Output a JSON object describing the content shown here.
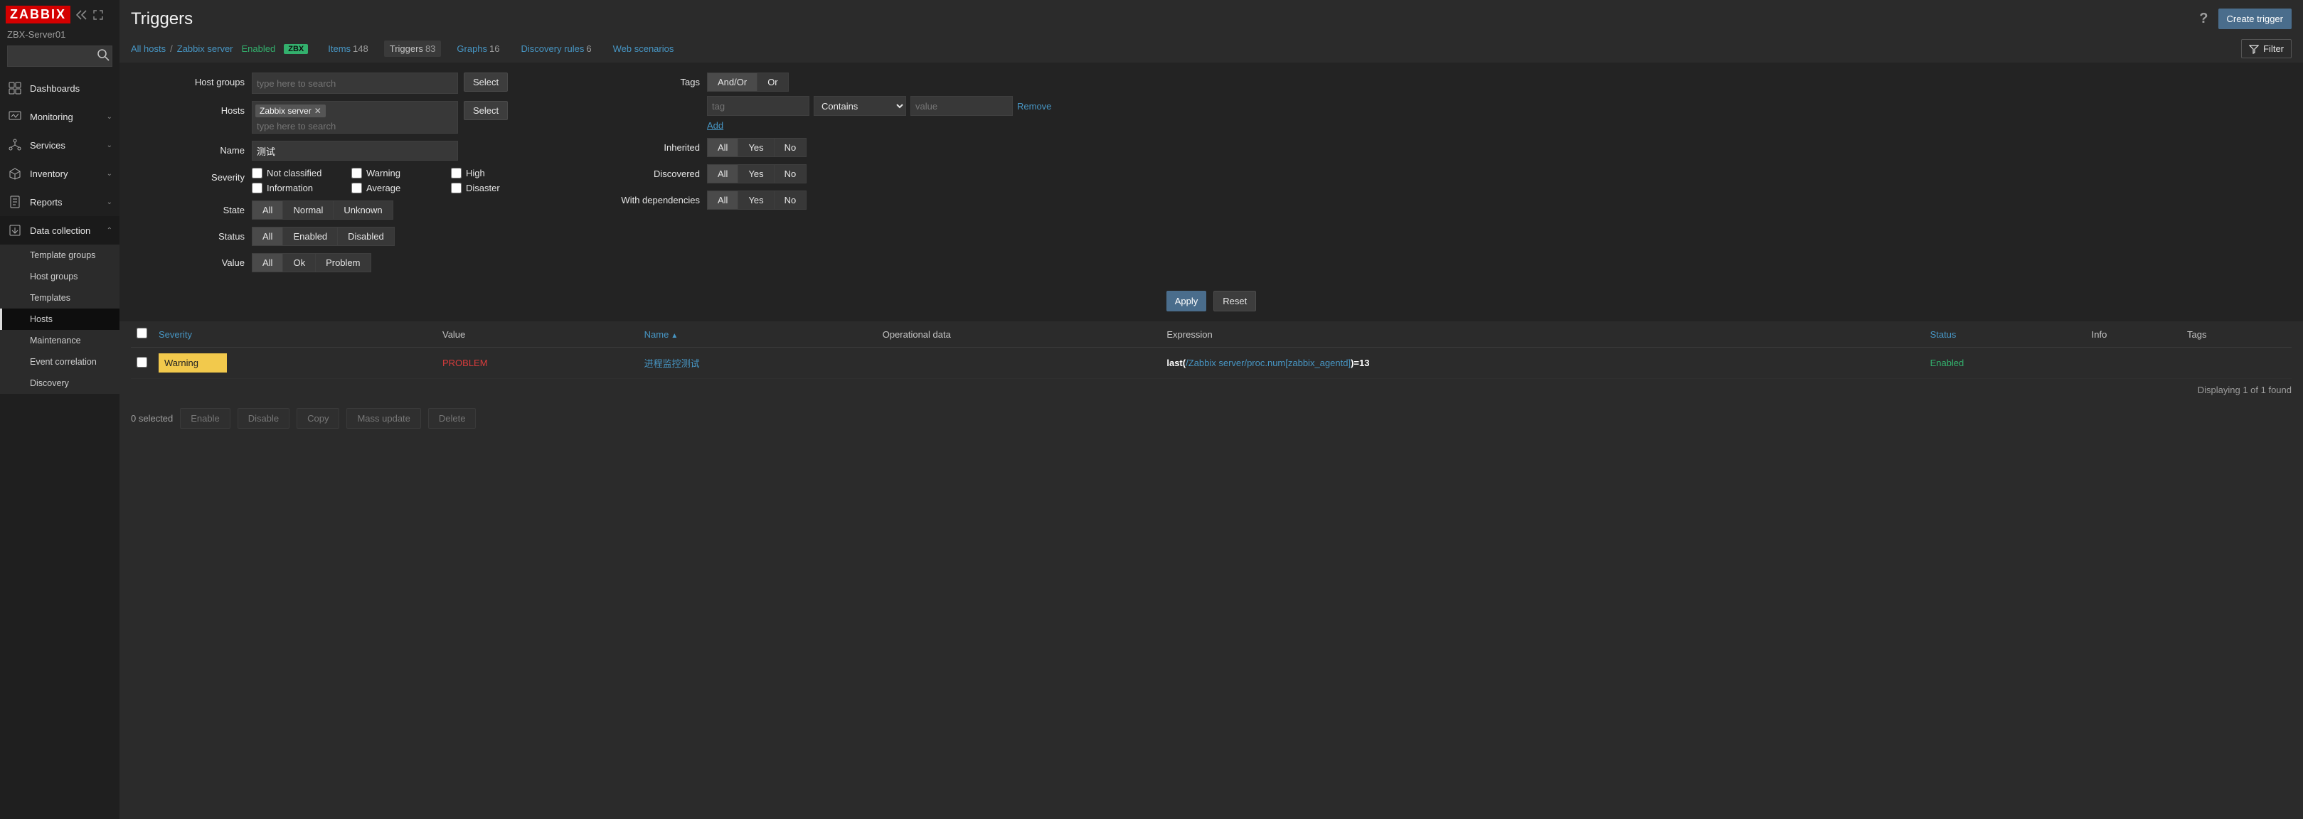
{
  "brand": "ZABBIX",
  "server_name": "ZBX-Server01",
  "search_placeholder": "",
  "sidebar": {
    "items": [
      {
        "label": "Dashboards",
        "icon": "dashboard-icon",
        "chev": false
      },
      {
        "label": "Monitoring",
        "icon": "monitor-icon",
        "chev": true
      },
      {
        "label": "Services",
        "icon": "services-icon",
        "chev": true
      },
      {
        "label": "Inventory",
        "icon": "inventory-icon",
        "chev": true
      },
      {
        "label": "Reports",
        "icon": "reports-icon",
        "chev": true
      },
      {
        "label": "Data collection",
        "icon": "data-collection-icon",
        "chev": true
      }
    ],
    "sub": [
      "Template groups",
      "Host groups",
      "Templates",
      "Hosts",
      "Maintenance",
      "Event correlation",
      "Discovery"
    ],
    "active_sub": "Hosts"
  },
  "header": {
    "title": "Triggers",
    "create_btn": "Create trigger",
    "help": "?"
  },
  "breadcrumb": {
    "all_hosts": "All hosts",
    "host": "Zabbix server",
    "status": "Enabled",
    "zbx": "ZBX"
  },
  "subtabs": [
    {
      "label": "Items",
      "count": "148",
      "active": false
    },
    {
      "label": "Triggers",
      "count": "83",
      "active": true
    },
    {
      "label": "Graphs",
      "count": "16",
      "active": false
    },
    {
      "label": "Discovery rules",
      "count": "6",
      "active": false
    },
    {
      "label": "Web scenarios",
      "count": "",
      "active": false
    }
  ],
  "filter_toggle": "Filter",
  "filter": {
    "host_groups_label": "Host groups",
    "hosts_label": "Hosts",
    "name_label": "Name",
    "severity_label": "Severity",
    "state_label": "State",
    "status_label": "Status",
    "value_label": "Value",
    "tags_label": "Tags",
    "inherited_label": "Inherited",
    "discovered_label": "Discovered",
    "with_deps_label": "With dependencies",
    "placeholder_search": "type here to search",
    "select_btn": "Select",
    "host_chip": "Zabbix server",
    "name_value": "测试",
    "severities": [
      "Not classified",
      "Warning",
      "High",
      "Information",
      "Average",
      "Disaster"
    ],
    "state_opts": [
      "All",
      "Normal",
      "Unknown"
    ],
    "status_opts": [
      "All",
      "Enabled",
      "Disabled"
    ],
    "value_opts": [
      "All",
      "Ok",
      "Problem"
    ],
    "yn_opts": [
      "All",
      "Yes",
      "No"
    ],
    "tags_andor": [
      "And/Or",
      "Or"
    ],
    "tag_placeholder": "tag",
    "tag_value_placeholder": "value",
    "tag_op_options": [
      "Contains"
    ],
    "tag_op_selected": "Contains",
    "remove": "Remove",
    "add": "Add",
    "apply": "Apply",
    "reset": "Reset"
  },
  "table": {
    "cols": {
      "severity": "Severity",
      "value": "Value",
      "name": "Name",
      "opdata": "Operational data",
      "expression": "Expression",
      "status": "Status",
      "info": "Info",
      "tags": "Tags"
    },
    "rows": [
      {
        "severity": "Warning",
        "value": "PROBLEM",
        "name": "进程监控测试",
        "opdata": "",
        "expr_prefix": "last(",
        "expr_link": "/Zabbix server/proc.num[zabbix_agentd]",
        "expr_suffix": ")=13",
        "status": "Enabled",
        "info": "",
        "tags": ""
      }
    ],
    "result_text": "Displaying 1 of 1 found"
  },
  "footer": {
    "selected": "0 selected",
    "buttons": [
      "Enable",
      "Disable",
      "Copy",
      "Mass update",
      "Delete"
    ]
  }
}
